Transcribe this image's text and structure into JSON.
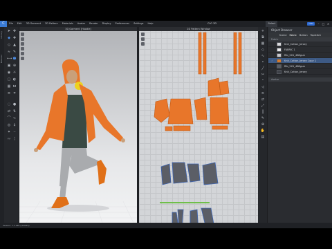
{
  "app": {
    "logo": "C",
    "menu": [
      "File",
      "Edit",
      "3D Garment",
      "2D Pattern",
      "Materials",
      "Avatar",
      "Render",
      "Display",
      "Preferences",
      "Settings",
      "Help"
    ],
    "mode_label": "Select",
    "window_title": "CLO 3D",
    "user": "user",
    "window_controls": [
      "–",
      "□",
      "×"
    ]
  },
  "left_toolbar": {
    "strip_labels": [
      "Library",
      "Modular"
    ],
    "tools": [
      "select-icon",
      "move-icon",
      "fold-icon",
      "pin-icon",
      "tack-icon",
      "fold-arrange-icon",
      "steam-icon",
      "brush-icon",
      "measure-icon",
      "avatar-icon",
      "arrange-icon",
      "zoom-icon",
      "camera-icon",
      "light-icon",
      "capture-icon",
      "shading-icon",
      "texture-icon",
      "mesh-icon",
      "layer-icon",
      "wireframe-icon"
    ]
  },
  "view3d": {
    "title": "3D Garment [Hoodie]"
  },
  "view2d": {
    "title": "2D Pattern Window"
  },
  "right_panel": {
    "header": "Object Browser",
    "tabs": [
      "Scene",
      "Fabric",
      "Button",
      "Topstitch"
    ],
    "section": "Fabric",
    "fabrics": [
      {
        "name": "Knit_Cotton_Jersey",
        "color": "#d9d9dc",
        "selected": false
      },
      {
        "name": "FABRIC 1",
        "color": "#ebebed",
        "selected": false
      },
      {
        "name": "Rib_2X1_468gsm",
        "color": "#c8c8cc",
        "selected": false
      },
      {
        "name": "Knit_Cotton_Jersey Copy 1",
        "color": "#d97a2b",
        "selected": true
      },
      {
        "name": "Rib_2X1_468gsm",
        "color": "#5b5e64",
        "selected": false
      },
      {
        "name": "Knit_Cotton_Jersey",
        "color": "#3d4047",
        "selected": false
      }
    ],
    "footer": "Avatar"
  },
  "statusbar": {
    "text": "Version: 7.1.240 (r43015)"
  },
  "colors": {
    "hoodie": "#e8762a",
    "shirt": "#3a4a44",
    "pants": "#a9abae",
    "boots": "#e07018",
    "accent": "#3a7bd5"
  }
}
